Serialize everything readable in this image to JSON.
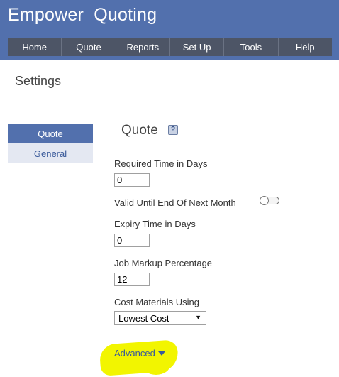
{
  "app": {
    "title": "Empower  Quoting"
  },
  "nav": {
    "items": [
      {
        "label": "Home"
      },
      {
        "label": "Quote"
      },
      {
        "label": "Reports"
      },
      {
        "label": "Set Up"
      },
      {
        "label": "Tools"
      },
      {
        "label": "Help"
      }
    ]
  },
  "page": {
    "title": "Settings"
  },
  "sidebar": {
    "items": [
      {
        "label": "Quote",
        "active": true
      },
      {
        "label": "General",
        "active": false
      }
    ]
  },
  "section": {
    "title": "Quote",
    "help_icon_glyph": "?"
  },
  "form": {
    "required_time": {
      "label": "Required Time in Days",
      "value": "0"
    },
    "valid_until": {
      "label": "Valid Until End Of Next Month",
      "toggle_on": false
    },
    "expiry_time": {
      "label": "Expiry Time in Days",
      "value": "0"
    },
    "job_markup": {
      "label": "Job Markup Percentage",
      "value": "12"
    },
    "cost_materials": {
      "label": "Cost Materials Using",
      "selected": "Lowest Cost"
    },
    "advanced": {
      "label": "Advanced"
    }
  },
  "colors": {
    "header_bg": "#5270ad",
    "navbar_bg": "#4d5566",
    "sidebar_active_bg": "#5270ad",
    "sidebar_inactive_bg": "#e4e8f2",
    "highlight": "#f2f500"
  }
}
